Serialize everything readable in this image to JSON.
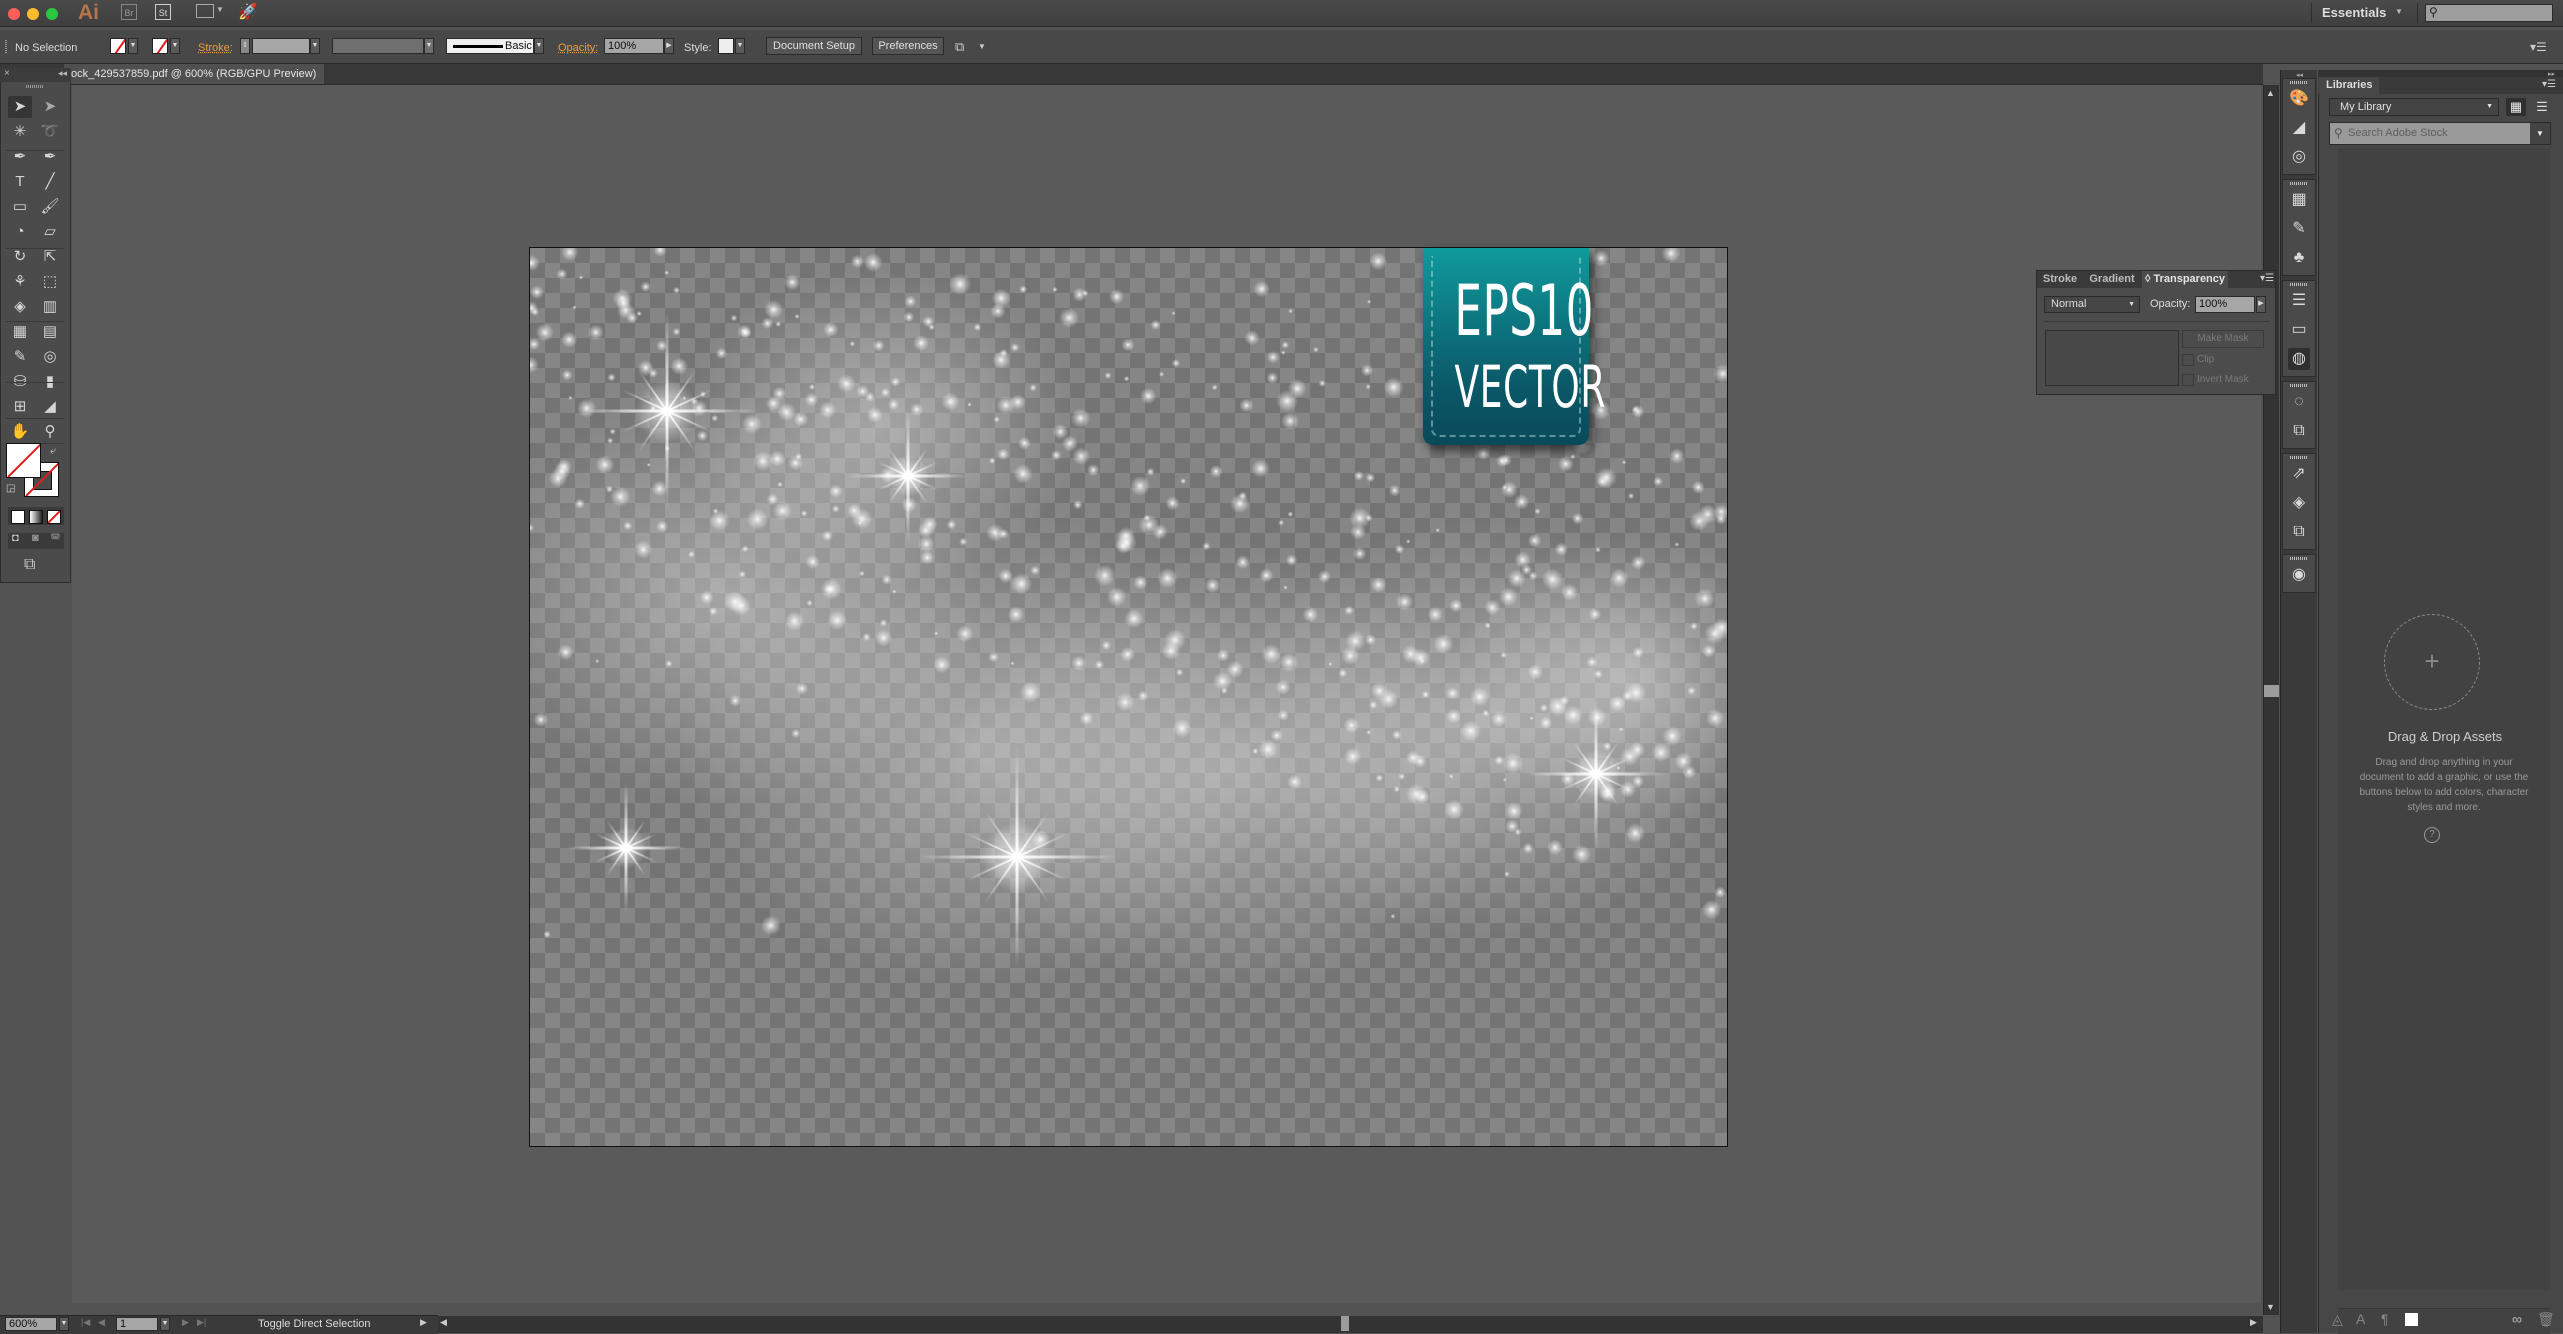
{
  "app": {
    "logo": "Ai",
    "bridge_label": "Br",
    "stock_label": "St",
    "workspace": "Essentials",
    "colors": {
      "accent_orange": "#e89f3e",
      "badge_teal": "#0f8f93",
      "stroke_none_red": "#e01b1b"
    }
  },
  "control_bar": {
    "selection_status": "No Selection",
    "stroke_label": "Stroke:",
    "stroke_weight": "",
    "brush_profile": "Basic",
    "opacity_label": "Opacity:",
    "opacity_value": "100%",
    "style_label": "Style:",
    "document_setup": "Document Setup",
    "preferences": "Preferences"
  },
  "document": {
    "tab_title": "ock_429537859.pdf @ 600% (RGB/GPU Preview)",
    "badge_line1": "EPS10",
    "badge_line2": "VECTOR"
  },
  "tools": [
    {
      "name": "selection-tool",
      "glyph": "➤"
    },
    {
      "name": "direct-selection-tool",
      "glyph": "➤"
    },
    {
      "name": "magic-wand-tool",
      "glyph": "✳"
    },
    {
      "name": "lasso-tool",
      "glyph": "➰"
    },
    {
      "name": "pen-tool",
      "glyph": "✒"
    },
    {
      "name": "curvature-tool",
      "glyph": "✒"
    },
    {
      "name": "type-tool",
      "glyph": "T"
    },
    {
      "name": "line-segment-tool",
      "glyph": "╱"
    },
    {
      "name": "rectangle-tool",
      "glyph": "▭"
    },
    {
      "name": "paintbrush-tool",
      "glyph": "🖌"
    },
    {
      "name": "shaper-tool",
      "glyph": "◔"
    },
    {
      "name": "eraser-tool",
      "glyph": "▱"
    },
    {
      "name": "rotate-tool",
      "glyph": "↻"
    },
    {
      "name": "scale-tool",
      "glyph": "⇱"
    },
    {
      "name": "puppet-warp-tool",
      "glyph": "⚘"
    },
    {
      "name": "free-transform-tool",
      "glyph": "⬚"
    },
    {
      "name": "shape-builder-tool",
      "glyph": "◈"
    },
    {
      "name": "perspective-grid-tool",
      "glyph": "▥"
    },
    {
      "name": "mesh-tool",
      "glyph": "▦"
    },
    {
      "name": "gradient-tool",
      "glyph": "▤"
    },
    {
      "name": "eyedropper-tool",
      "glyph": "✎"
    },
    {
      "name": "blend-tool",
      "glyph": "◎"
    },
    {
      "name": "symbol-sprayer-tool",
      "glyph": "⛁"
    },
    {
      "name": "column-graph-tool",
      "glyph": "▮"
    },
    {
      "name": "artboard-tool",
      "glyph": "⊞"
    },
    {
      "name": "slice-tool",
      "glyph": "◢"
    },
    {
      "name": "hand-tool",
      "glyph": "✋"
    },
    {
      "name": "zoom-tool",
      "glyph": "⚲"
    }
  ],
  "transparency_panel": {
    "tabs": [
      "Stroke",
      "Gradient",
      "◊ Transparency"
    ],
    "blend_mode": "Normal",
    "opacity_label": "Opacity:",
    "opacity_value": "100%",
    "make_mask": "Make Mask",
    "clip": "Clip",
    "invert_mask": "Invert Mask"
  },
  "libraries": {
    "tab": "Libraries",
    "library": "My Library",
    "search_placeholder": "Search Adobe Stock",
    "drop_title": "Drag & Drop Assets",
    "drop_desc": "Drag and drop anything in your document to add a graphic, or use the buttons below to add colors, character styles and more.",
    "help": "?"
  },
  "dock_icons": [
    "color-icon",
    "color-guide-icon",
    "color-themes-icon",
    "swatches-icon",
    "brushes-icon",
    "symbols-icon",
    "stroke-icon",
    "gradient-icon",
    "transparency-icon",
    "appearance-icon",
    "graphic-styles-icon",
    "export-icon",
    "layers-icon",
    "artboards-icon",
    "navigator-icon"
  ],
  "status_bar": {
    "zoom": "600%",
    "artboard_number": "1",
    "current_tool": "Toggle Direct Selection"
  }
}
